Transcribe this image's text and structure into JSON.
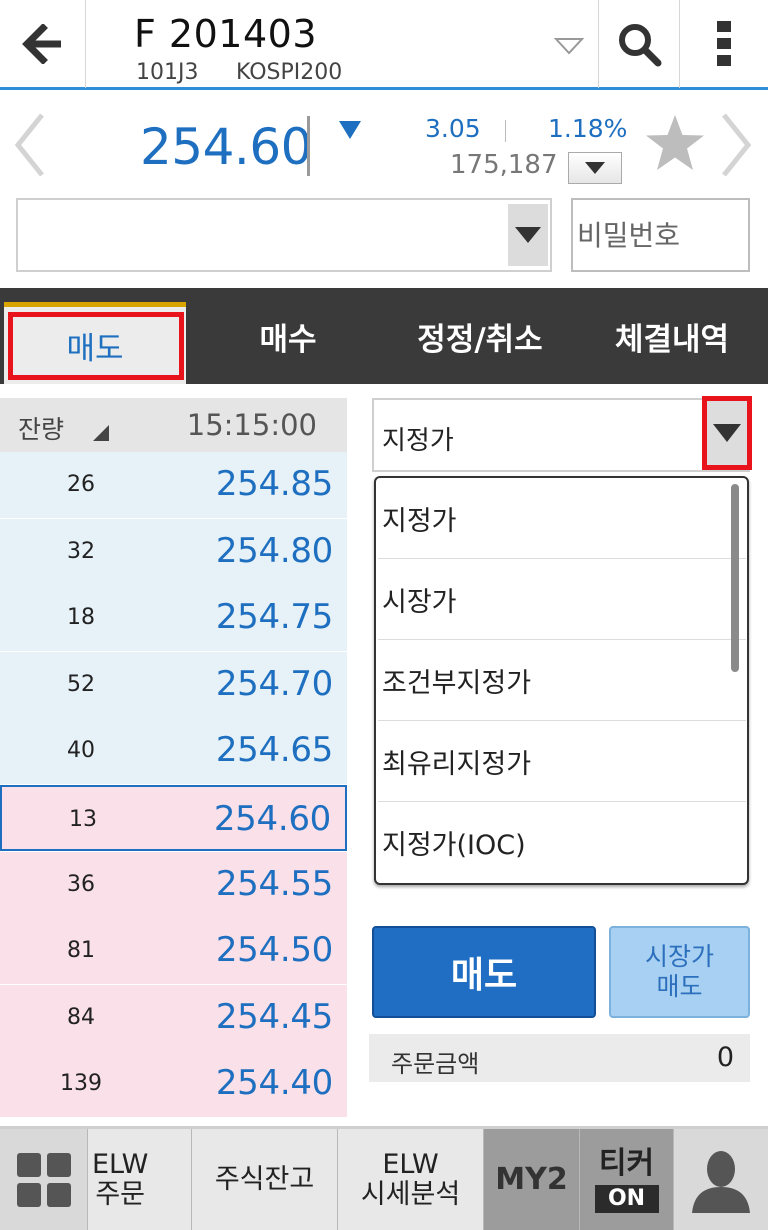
{
  "header": {
    "title": "F 201403",
    "code": "101J3",
    "index": "KOSPI200"
  },
  "quote": {
    "price": "254.60",
    "change": "3.05",
    "change_rate": "1.18%",
    "volume": "175,187"
  },
  "account": {
    "selected": "",
    "password_placeholder": "비밀번호"
  },
  "tabs": [
    {
      "label": "매도",
      "active": true
    },
    {
      "label": "매수",
      "active": false
    },
    {
      "label": "정정/취소",
      "active": false
    },
    {
      "label": "체결내역",
      "active": false
    }
  ],
  "orderbook": {
    "qty_label": "잔량",
    "time": "15:15:00",
    "rows": [
      {
        "qty": "26",
        "price": "254.85",
        "side": "ask"
      },
      {
        "qty": "32",
        "price": "254.80",
        "side": "ask"
      },
      {
        "qty": "18",
        "price": "254.75",
        "side": "ask"
      },
      {
        "qty": "52",
        "price": "254.70",
        "side": "ask"
      },
      {
        "qty": "40",
        "price": "254.65",
        "side": "ask"
      },
      {
        "qty": "13",
        "price": "254.60",
        "side": "bid",
        "current": true
      },
      {
        "qty": "36",
        "price": "254.55",
        "side": "bid"
      },
      {
        "qty": "81",
        "price": "254.50",
        "side": "bid"
      },
      {
        "qty": "84",
        "price": "254.45",
        "side": "bid"
      },
      {
        "qty": "139",
        "price": "254.40",
        "side": "bid"
      }
    ]
  },
  "order": {
    "type_value": "지정가",
    "type_options": [
      "지정가",
      "시장가",
      "조건부지정가",
      "최유리지정가",
      "지정가(IOC)"
    ],
    "sell_label": "매도",
    "market_sell_line1": "시장가",
    "market_sell_line2": "매도",
    "amount_label": "주문금액",
    "amount_value": "0"
  },
  "bottombar": {
    "elw_order_line1": "ELW",
    "elw_order_line2": "주문",
    "stock_balance": "주식잔고",
    "elw_analysis_line1": "ELW",
    "elw_analysis_line2": "시세분석",
    "my2": "MY2",
    "ticker_label": "티커",
    "ticker_state": "ON"
  },
  "colors": {
    "accent_blue": "#1e6fc0",
    "header_line": "#2f8fd8",
    "ask_bg": "#e6f1f8",
    "bid_bg": "#fae0e8",
    "highlight_red": "#e8131b",
    "tab_bar": "#3a3a3a"
  },
  "icons": [
    "back-arrow-icon",
    "search-icon",
    "more-vert-icon",
    "chevron-left-icon",
    "chevron-right-icon",
    "triangle-down-icon",
    "star-icon",
    "grid-icon",
    "user-icon"
  ]
}
